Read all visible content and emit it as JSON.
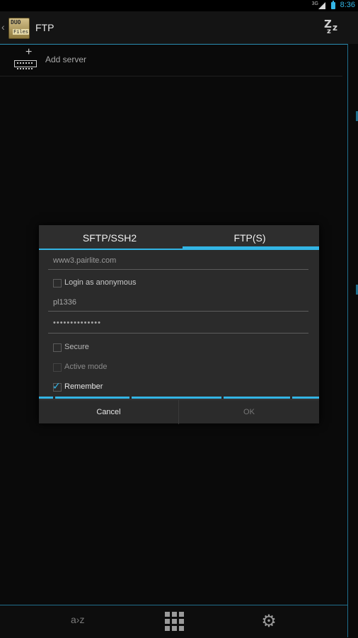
{
  "status_bar": {
    "network": "3G",
    "time": "8:36"
  },
  "action_bar": {
    "app_icon_text_top": "DUO",
    "app_icon_text_bottom": "Files",
    "title": "FTP",
    "sleep_icon": "sleep-zzz-icon"
  },
  "list": {
    "add_server_label": "Add server"
  },
  "dialog": {
    "tabs": [
      {
        "label": "SFTP/SSH2",
        "selected": false
      },
      {
        "label": "FTP(S)",
        "selected": true
      }
    ],
    "host_value": "www3.pairlite.com",
    "anonymous_label": "Login as anonymous",
    "anonymous_checked": false,
    "username_value": "pl1336",
    "password_value": "••••••••••••••",
    "secure_label": "Secure",
    "secure_checked": false,
    "active_mode_label": "Active mode",
    "active_mode_checked": false,
    "remember_label": "Remember",
    "remember_checked": true,
    "cancel_label": "Cancel",
    "ok_label": "OK"
  },
  "bottom_bar": {
    "sort_label": "a›z",
    "grid_icon": "grid-icon",
    "settings_icon": "gear-icon"
  },
  "colors": {
    "accent": "#33b5e5",
    "background": "#0a0a0a",
    "dialog": "#2b2b2b"
  }
}
